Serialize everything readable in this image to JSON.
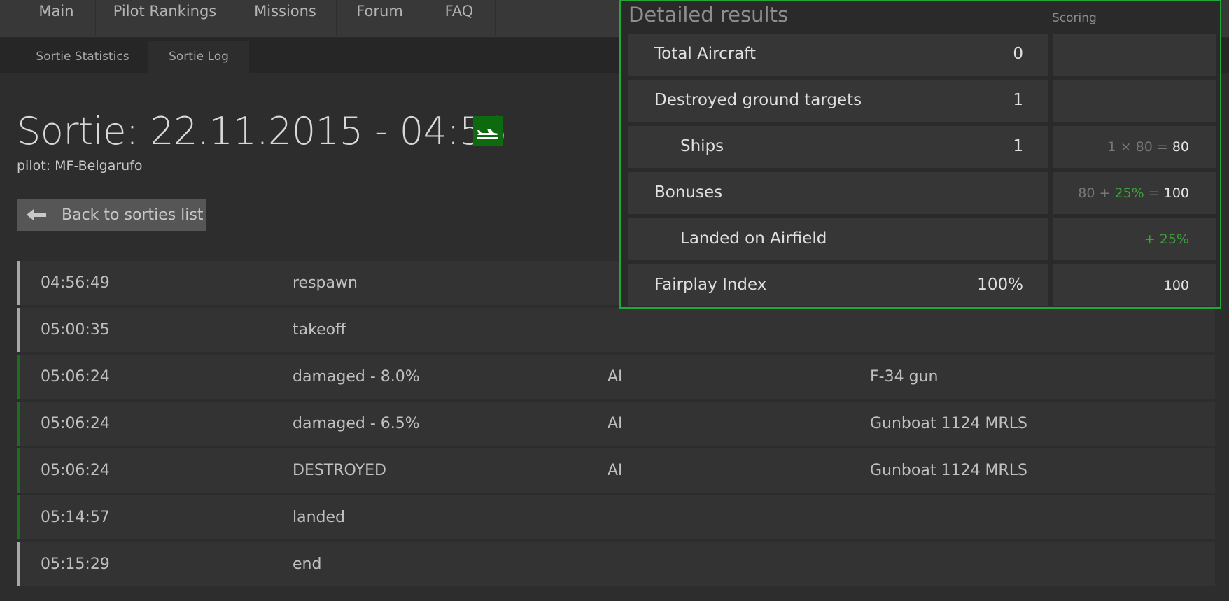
{
  "nav": {
    "items": [
      {
        "label": "Main"
      },
      {
        "label": "Pilot Rankings"
      },
      {
        "label": "Missions"
      },
      {
        "label": "Forum"
      },
      {
        "label": "FAQ"
      }
    ]
  },
  "subnav": {
    "items": [
      {
        "label": "Sortie Statistics",
        "active": false
      },
      {
        "label": "Sortie Log",
        "active": true
      }
    ]
  },
  "sortie": {
    "title": "Sortie: 22.11.2015 - 04:56",
    "pilot": "pilot: MF-Belgarufo",
    "aircraft_icon": "plane-icon",
    "back_label": "Back to sorties list",
    "back_icon": "arrow-left-icon"
  },
  "log": {
    "rows": [
      {
        "time": "04:56:49",
        "event": "respawn",
        "actor": "",
        "object": "",
        "status": "neutral"
      },
      {
        "time": "05:00:35",
        "event": "takeoff",
        "actor": "",
        "object": "",
        "status": "neutral"
      },
      {
        "time": "05:06:24",
        "event": "damaged - 8.0%",
        "actor": "AI",
        "object": "F-34 gun",
        "status": "success"
      },
      {
        "time": "05:06:24",
        "event": "damaged - 6.5%",
        "actor": "AI",
        "object": "Gunboat 1124 MRLS",
        "status": "success"
      },
      {
        "time": "05:06:24",
        "event": "DESTROYED",
        "actor": "AI",
        "object": "Gunboat 1124 MRLS",
        "status": "success"
      },
      {
        "time": "05:14:57",
        "event": "landed",
        "actor": "",
        "object": "",
        "status": "success"
      },
      {
        "time": "05:15:29",
        "event": "end",
        "actor": "",
        "object": "",
        "status": "neutral"
      }
    ]
  },
  "results": {
    "title": "Detailed results",
    "scoring_header": "Scoring",
    "rows": {
      "total_aircraft": {
        "label": "Total Aircraft",
        "value": "0"
      },
      "ground_targets": {
        "label": "Destroyed ground targets",
        "value": "1"
      },
      "ships": {
        "label": "Ships",
        "value": "1",
        "formula": "1 × 80 =",
        "result": "80"
      },
      "bonuses": {
        "label": "Bonuses",
        "base": "80 +",
        "percent": "25%",
        "eq": "=",
        "result": "100"
      },
      "landed": {
        "label": "Landed on Airfield",
        "bonus": "+ 25%"
      },
      "fairplay": {
        "label": "Fairplay Index",
        "value": "100%",
        "result": "100"
      }
    }
  },
  "colors": {
    "panel_border": "#20a83a",
    "success_bar": "#1f6e1f",
    "neutral_bar": "#a8a8a8",
    "badge_bg": "#0e6a0e",
    "bonus_green": "#3aa03a"
  }
}
